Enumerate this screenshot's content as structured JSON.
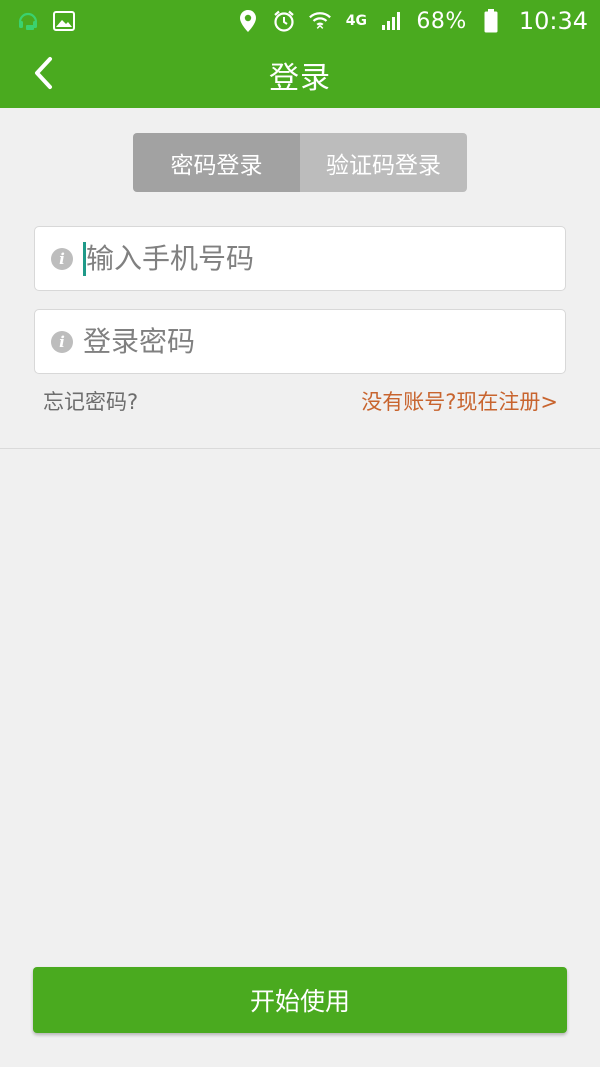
{
  "status_bar": {
    "battery_percent": "68%",
    "time": "10:34",
    "network_label": "4G",
    "icons": [
      "headset-app-icon",
      "gallery-icon",
      "location-icon",
      "alarm-icon",
      "wifi-icon",
      "network-4g-icon",
      "signal-icon",
      "battery-icon"
    ]
  },
  "app_bar": {
    "title": "登录",
    "back_icon": "chevron-left-icon"
  },
  "tabs": [
    {
      "label": "密码登录",
      "active": true
    },
    {
      "label": "验证码登录",
      "active": false
    }
  ],
  "form": {
    "phone_placeholder": "输入手机号码",
    "password_placeholder": "登录密码"
  },
  "links": {
    "forgot_password": "忘记密码?",
    "register": "没有账号?现在注册>"
  },
  "start_button": {
    "label": "开始使用"
  },
  "colors": {
    "brand_green": "#4aaa1f",
    "link_orange": "#c8642e",
    "background": "#f0f0f0"
  }
}
